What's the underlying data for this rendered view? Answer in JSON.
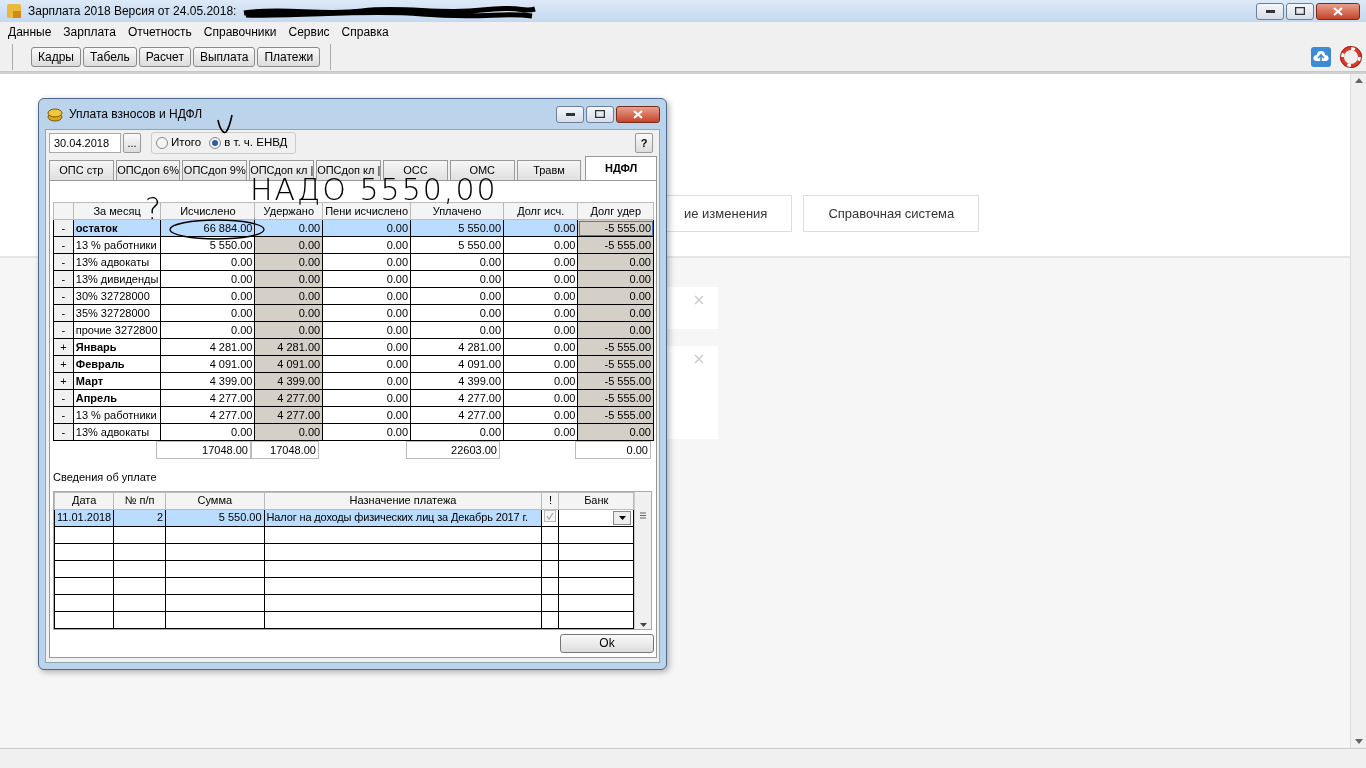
{
  "window": {
    "title": "Зарплата 2018 Версия от 24.05.2018:"
  },
  "menu": [
    "Данные",
    "Зарплата",
    "Отчетность",
    "Справочники",
    "Сервис",
    "Справка"
  ],
  "toolbar": [
    "Кадры",
    "Табель",
    "Расчет",
    "Выплата",
    "Платежи"
  ],
  "background": {
    "buttons": [
      "ие изменения",
      "Справочная система"
    ]
  },
  "dialog": {
    "title": "Уплата взносов и НДФЛ",
    "date": "30.04.2018",
    "date_button": "...",
    "help_button": "?",
    "options": [
      {
        "label": "Итого",
        "selected": false
      },
      {
        "label": "в т. ч. ЕНВД",
        "selected": true
      }
    ],
    "tabs": [
      {
        "label": "ОПС стр",
        "selected": false
      },
      {
        "label": "ОПСдоп 6%",
        "selected": false
      },
      {
        "label": "ОПСдоп 9%",
        "selected": false
      },
      {
        "label": "ОПСдоп кл |",
        "selected": false
      },
      {
        "label": "ОПСдоп кл |",
        "selected": false
      },
      {
        "label": "ОСС",
        "selected": false
      },
      {
        "label": "ОМС",
        "selected": false
      },
      {
        "label": "Травм",
        "selected": false
      },
      {
        "label": "НДФЛ",
        "selected": true
      }
    ],
    "columns": [
      {
        "label": "За месяц",
        "shaded": false
      },
      {
        "label": "Исчислено",
        "shaded": false,
        "total": "17048.00"
      },
      {
        "label": "Удержано",
        "shaded": true,
        "total": "17048.00"
      },
      {
        "label": "Пени исчислено",
        "shaded": false
      },
      {
        "label": "Уплачено",
        "shaded": false,
        "total": "22603.00"
      },
      {
        "label": "Долг исч.",
        "shaded": false
      },
      {
        "label": "Долг удер",
        "shaded": true,
        "total": "0.00"
      }
    ],
    "rows": [
      {
        "toggle": "-",
        "label": "остаток",
        "summary": true,
        "selected": true,
        "values": [
          "66 884.00",
          "0.00",
          "0.00",
          "5 550.00",
          "0.00",
          "-5 555.00"
        ]
      },
      {
        "toggle": "-",
        "label": "13 % работники",
        "summary": false,
        "selected": false,
        "values": [
          "5 550.00",
          "0.00",
          "0.00",
          "5 550.00",
          "0.00",
          "-5 555.00"
        ]
      },
      {
        "toggle": "-",
        "label": "13% адвокаты",
        "summary": false,
        "selected": false,
        "values": [
          "0.00",
          "0.00",
          "0.00",
          "0.00",
          "0.00",
          "0.00"
        ]
      },
      {
        "toggle": "-",
        "label": "13% дивиденды",
        "summary": false,
        "selected": false,
        "values": [
          "0.00",
          "0.00",
          "0.00",
          "0.00",
          "0.00",
          "0.00"
        ]
      },
      {
        "toggle": "-",
        "label": "30% 32728000",
        "summary": false,
        "selected": false,
        "values": [
          "0.00",
          "0.00",
          "0.00",
          "0.00",
          "0.00",
          "0.00"
        ]
      },
      {
        "toggle": "-",
        "label": "35% 32728000",
        "summary": false,
        "selected": false,
        "values": [
          "0.00",
          "0.00",
          "0.00",
          "0.00",
          "0.00",
          "0.00"
        ]
      },
      {
        "toggle": "-",
        "label": "прочие 3272800",
        "summary": false,
        "selected": false,
        "values": [
          "0.00",
          "0.00",
          "0.00",
          "0.00",
          "0.00",
          "0.00"
        ]
      },
      {
        "toggle": "+",
        "label": "Январь",
        "summary": true,
        "selected": false,
        "values": [
          "4 281.00",
          "4 281.00",
          "0.00",
          "4 281.00",
          "0.00",
          "-5 555.00"
        ]
      },
      {
        "toggle": "+",
        "label": "Февраль",
        "summary": true,
        "selected": false,
        "values": [
          "4 091.00",
          "4 091.00",
          "0.00",
          "4 091.00",
          "0.00",
          "-5 555.00"
        ]
      },
      {
        "toggle": "+",
        "label": "Март",
        "summary": true,
        "selected": false,
        "values": [
          "4 399.00",
          "4 399.00",
          "0.00",
          "4 399.00",
          "0.00",
          "-5 555.00"
        ]
      },
      {
        "toggle": "-",
        "label": "Апрель",
        "summary": true,
        "selected": false,
        "values": [
          "4 277.00",
          "4 277.00",
          "0.00",
          "4 277.00",
          "0.00",
          "-5 555.00"
        ]
      },
      {
        "toggle": "-",
        "label": "13 % работники",
        "summary": false,
        "selected": false,
        "values": [
          "4 277.00",
          "4 277.00",
          "0.00",
          "4 277.00",
          "0.00",
          "-5 555.00"
        ]
      },
      {
        "toggle": "-",
        "label": "13% адвокаты",
        "summary": false,
        "selected": false,
        "values": [
          "0.00",
          "0.00",
          "0.00",
          "0.00",
          "0.00",
          "0.00"
        ]
      }
    ],
    "payments": {
      "title": "Сведения об уплате",
      "columns": [
        "Дата",
        "№ п/п",
        "Сумма",
        "Назначение платежа",
        "!",
        "Банк"
      ],
      "rows": [
        {
          "date": "11.01.2018",
          "number": "2",
          "amount": "5 550.00",
          "purpose": "Налог на доходы физических лиц за Декабрь 2017 г.",
          "checked": true,
          "selected": true
        }
      ]
    },
    "ok_button": "Ok"
  },
  "annotations": [
    {
      "text": "НАДО 5550,00"
    },
    {
      "text": "?"
    }
  ]
}
